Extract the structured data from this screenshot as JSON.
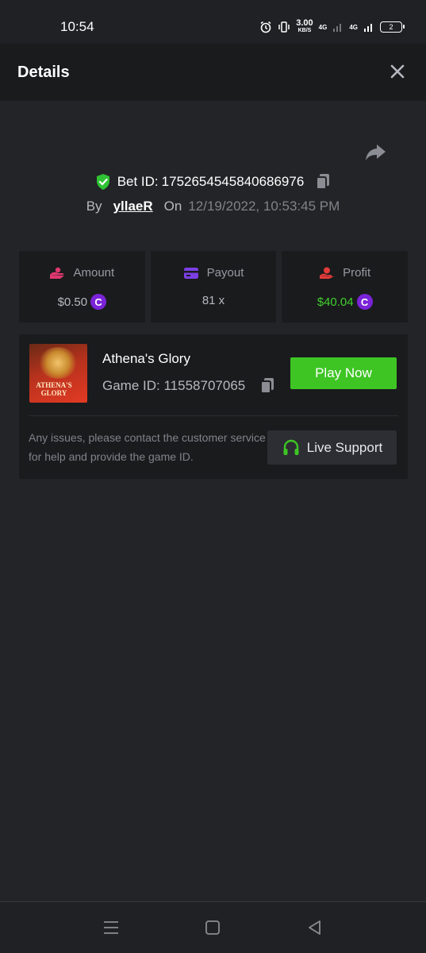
{
  "status_bar": {
    "time": "10:54",
    "net_speed_value": "3.00",
    "net_speed_unit": "KB/S",
    "network_1": "4G",
    "network_2": "4G",
    "battery": "2"
  },
  "header": {
    "title": "Details"
  },
  "bet": {
    "id_label": "Bet ID:",
    "id_value": "1752654545840686976",
    "by_label": "By",
    "username": "yllaeR",
    "on_label": "On",
    "date": "12/19/2022, 10:53:45 PM"
  },
  "stats": [
    {
      "label": "Amount",
      "value": "$0.50",
      "icon": "coins-hand-icon",
      "coin": "C"
    },
    {
      "label": "Payout",
      "value": "81 x",
      "icon": "card-icon"
    },
    {
      "label": "Profit",
      "value": "$40.04",
      "icon": "money-hand-icon",
      "coin": "C"
    }
  ],
  "game": {
    "thumb_text": "ATHENA'S GLORY",
    "name": "Athena's Glory",
    "id_label": "Game ID:",
    "id_value": "11558707065",
    "play_label": "Play Now",
    "help_text": "Any issues, please contact the customer service for help and provide the game ID.",
    "support_label": "Live Support"
  },
  "colors": {
    "background": "#232427",
    "panel": "#1a1b1d",
    "accent_green": "#3ec524",
    "coin_purple": "#7a23d8",
    "amount_pink": "#e0386e",
    "payout_purple": "#7b3fe4",
    "profit_red": "#e23a3a"
  }
}
